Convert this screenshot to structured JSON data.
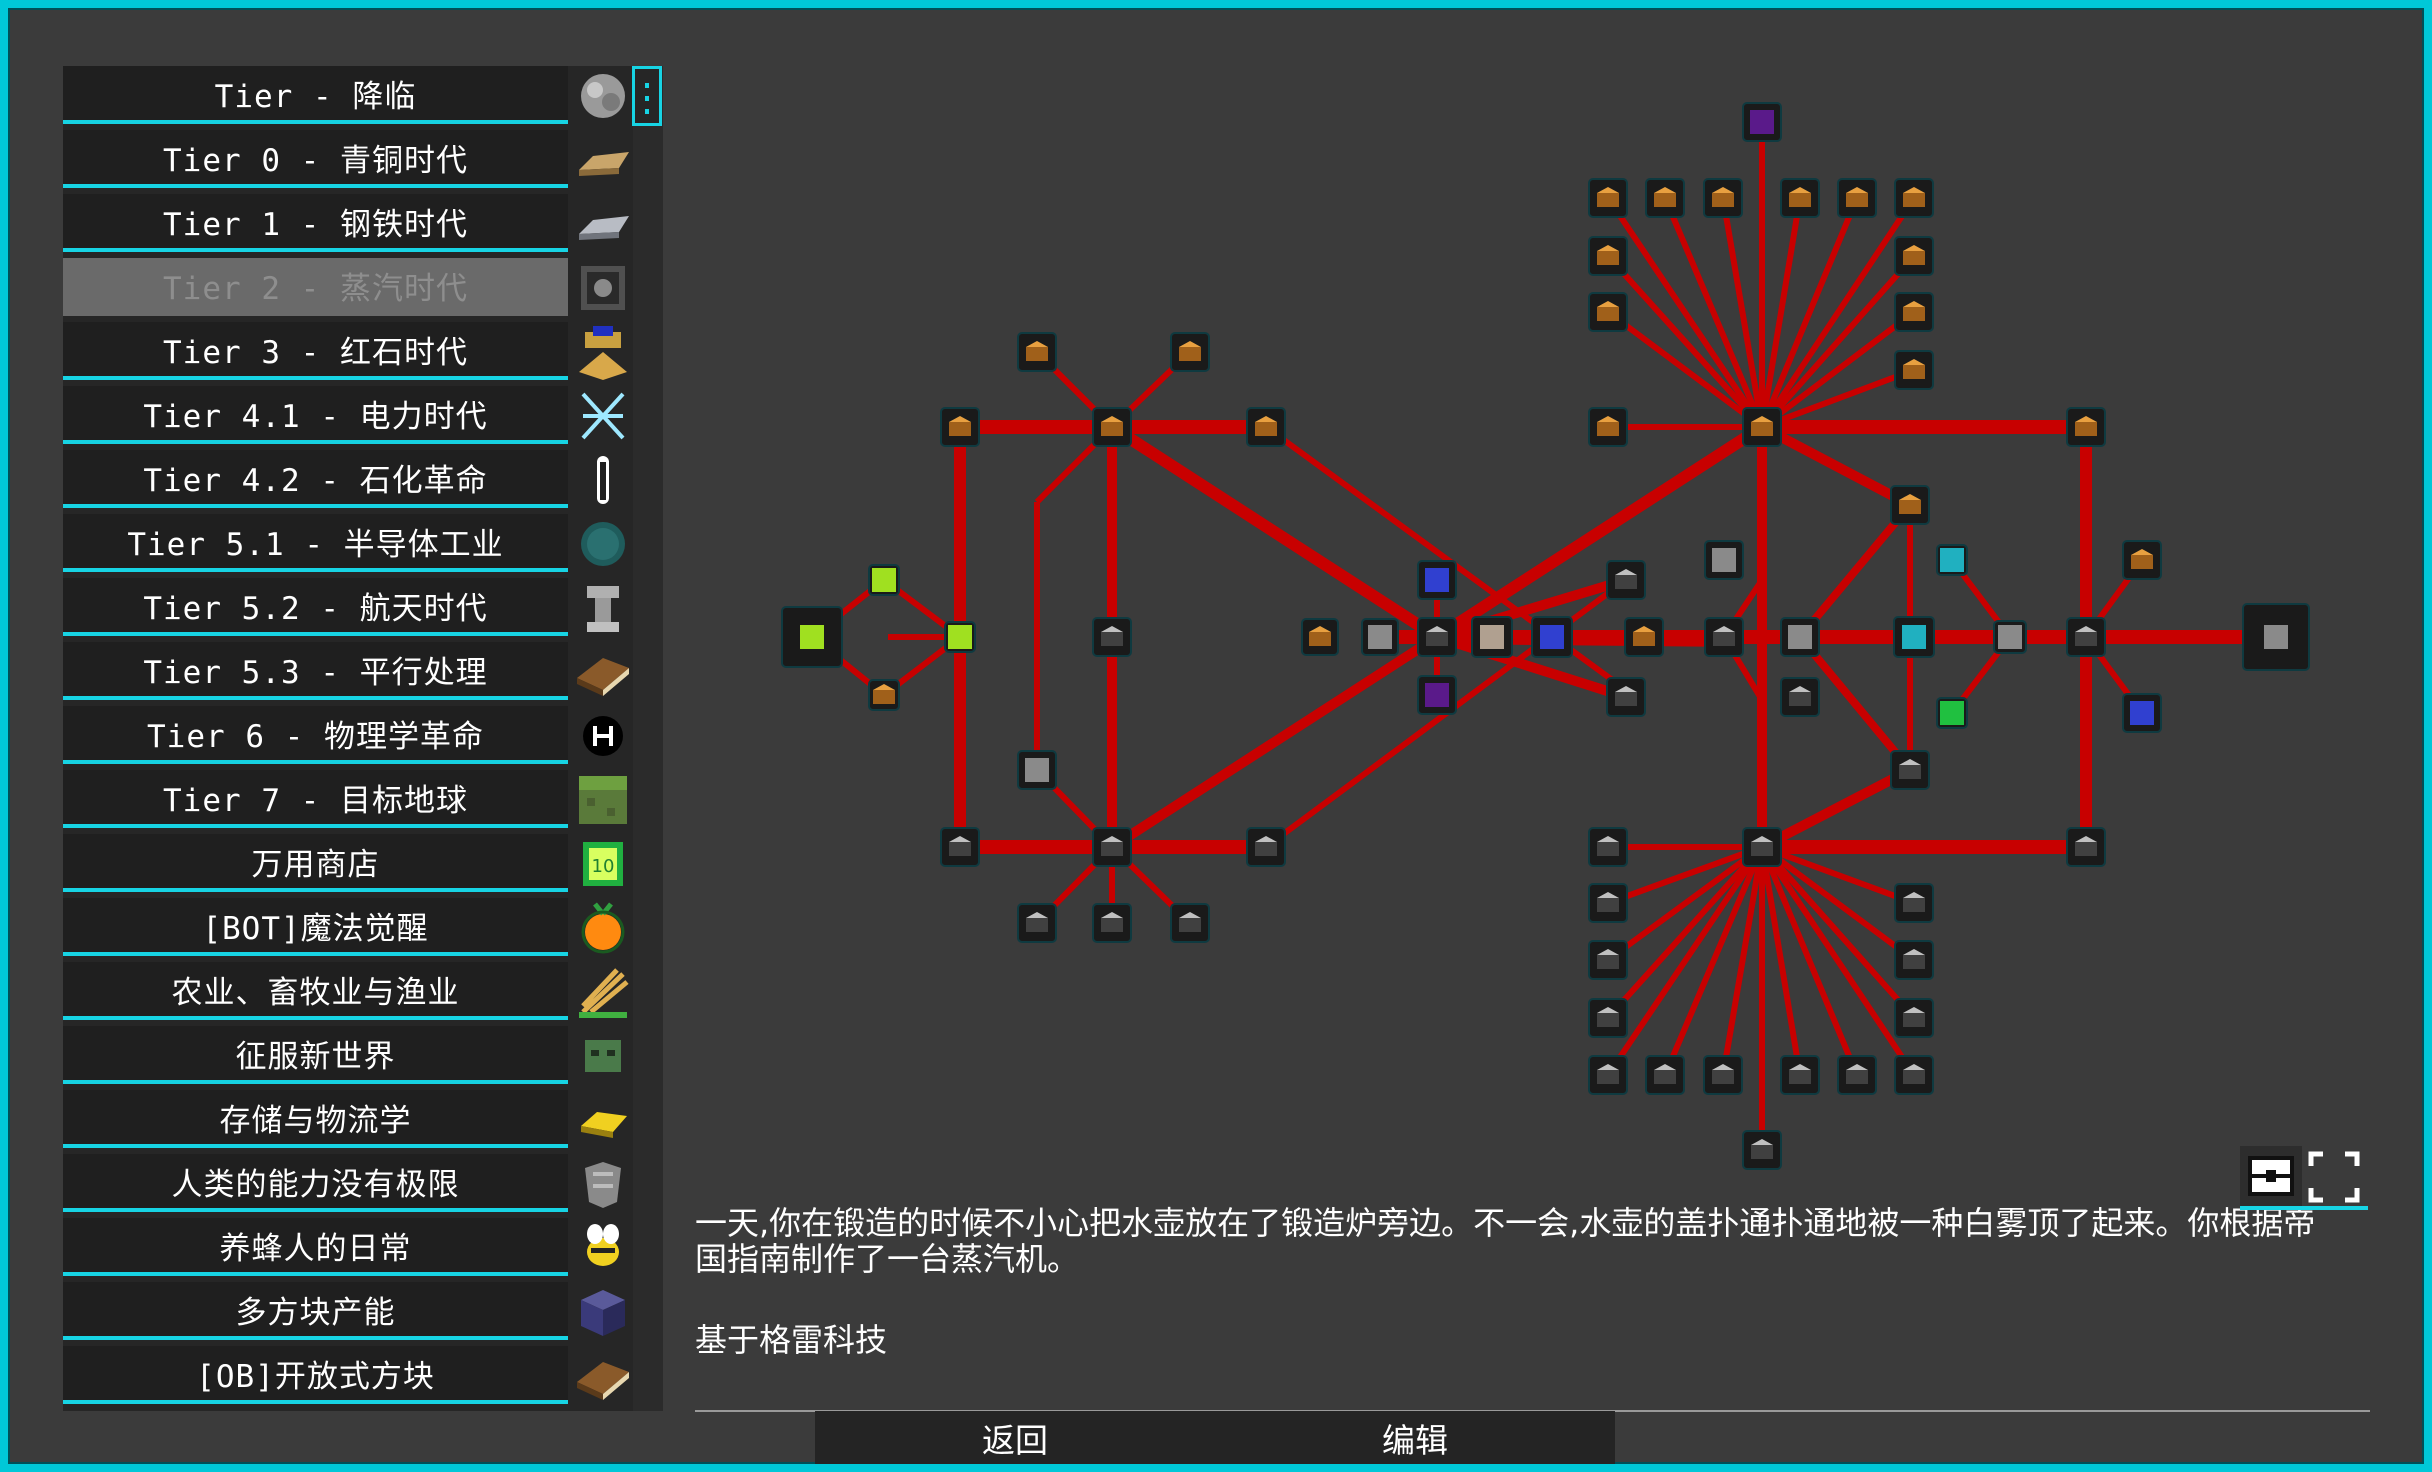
{
  "sidebar": {
    "categories": [
      {
        "label": "Tier - 降临",
        "icon": "gray-ore-icon",
        "selected": false
      },
      {
        "label": "Tier 0 - 青铜时代",
        "icon": "bronze-ingot-icon",
        "selected": false
      },
      {
        "label": "Tier 1 - 钢铁时代",
        "icon": "steel-ingot-icon",
        "selected": false
      },
      {
        "label": "Tier 2 - 蒸汽时代",
        "icon": "steam-machine-icon",
        "selected": true
      },
      {
        "label": "Tier 3 - 红石时代",
        "icon": "redstone-machine-icon",
        "selected": false
      },
      {
        "label": "Tier 4.1 - 电力时代",
        "icon": "lightning-icon",
        "selected": false
      },
      {
        "label": "Tier 4.2 - 石化革命",
        "icon": "test-tube-icon",
        "selected": false
      },
      {
        "label": "Tier 5.1 - 半导体工业",
        "icon": "wafer-icon",
        "selected": false
      },
      {
        "label": "Tier 5.2 - 航天时代",
        "icon": "rocket-part-icon",
        "selected": false
      },
      {
        "label": "Tier 5.3 - 平行处理",
        "icon": "book-icon",
        "selected": false
      },
      {
        "label": "Tier 6 - 物理学革命",
        "icon": "physics-logo-icon",
        "selected": false
      },
      {
        "label": "Tier 7 - 目标地球",
        "icon": "grass-block-icon",
        "selected": false
      },
      {
        "label": "万用商店",
        "icon": "coin-icon",
        "selected": false
      },
      {
        "label": "[BOT]魔法觉醒",
        "icon": "orange-fruit-icon",
        "selected": false
      },
      {
        "label": "农业、畜牧业与渔业",
        "icon": "wheat-icon",
        "selected": false
      },
      {
        "label": "征服新世界",
        "icon": "zombie-head-icon",
        "selected": false
      },
      {
        "label": "存储与物流学",
        "icon": "gold-bar-icon",
        "selected": false
      },
      {
        "label": "人类的能力没有极限",
        "icon": "armor-icon",
        "selected": false
      },
      {
        "label": "养蜂人的日常",
        "icon": "bee-icon",
        "selected": false
      },
      {
        "label": "多方块产能",
        "icon": "purple-block-icon",
        "selected": false
      },
      {
        "label": "[OB]开放式方块",
        "icon": "book-icon",
        "selected": false
      }
    ]
  },
  "description": "一天,你在锻造的时候不小心把水壶放在了锻造炉旁边。不一会,水壶的盖扑通扑通地被一种白雾顶了起来。你根据帝国指南制作了一台蒸汽机。",
  "based_on": "基于格雷科技",
  "buttons": {
    "back": "返回",
    "edit": "编辑"
  },
  "tools": {
    "left": "chest-icon",
    "right": "fullscreen-icon"
  },
  "colors": {
    "accent": "#17d4e4",
    "link": "#c80000",
    "background": "#3b3b3b",
    "border": "#00c8d8"
  }
}
